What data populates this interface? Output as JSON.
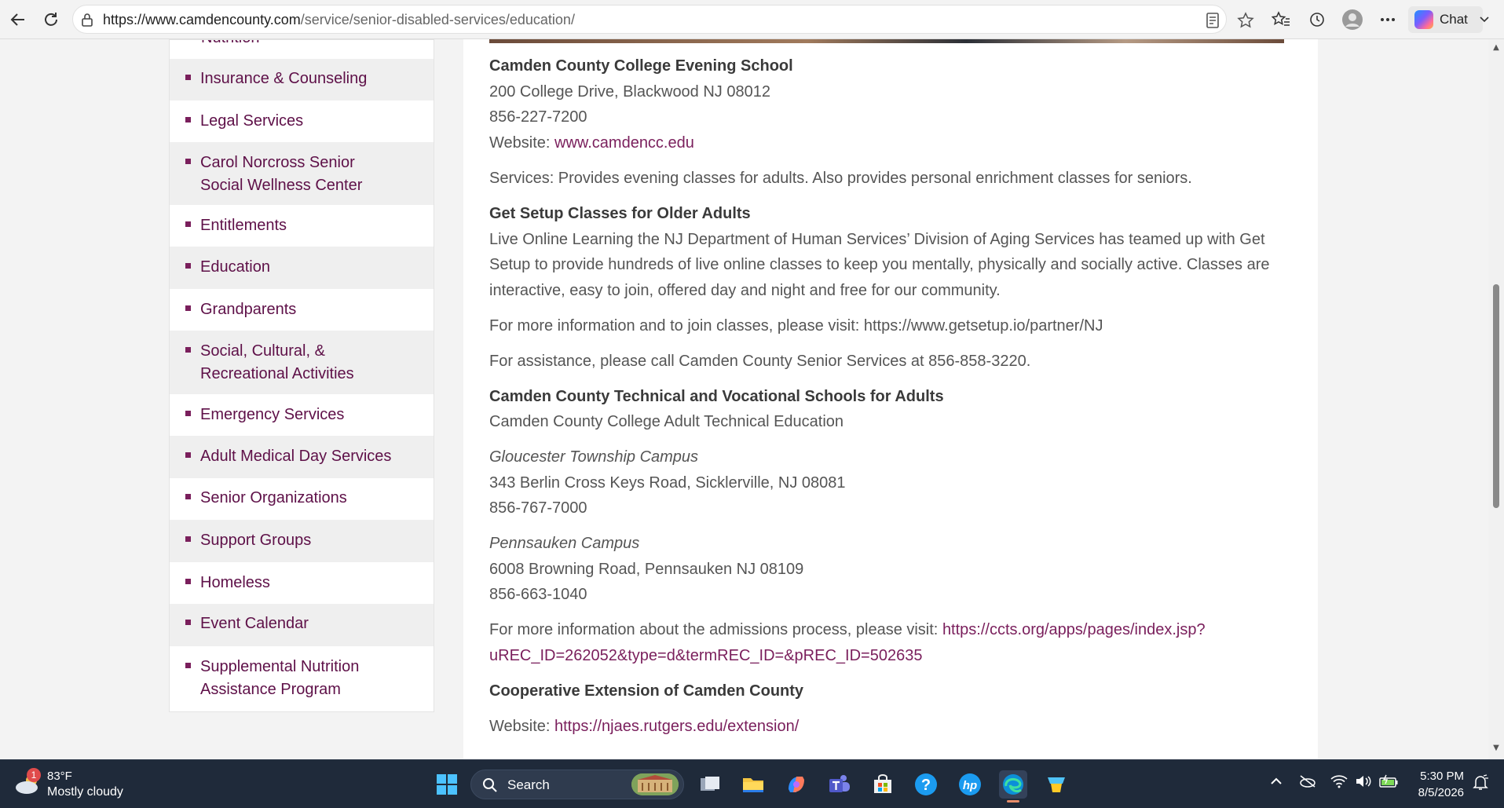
{
  "browser": {
    "url_host": "https://www.camdencounty.com",
    "url_path": "/service/senior-disabled-services/education/",
    "chat_label": "Chat"
  },
  "sidebar": {
    "cut_label": "Nutrition",
    "items": [
      {
        "label": "Insurance & Counseling"
      },
      {
        "label": "Legal Services"
      },
      {
        "label": "Carol Norcross Senior Social Wellness Center"
      },
      {
        "label": "Entitlements"
      },
      {
        "label": "Education"
      },
      {
        "label": "Grandparents"
      },
      {
        "label": "Social, Cultural, & Recreational Activities"
      },
      {
        "label": "Emergency Services"
      },
      {
        "label": "Adult Medical Day Services"
      },
      {
        "label": "Senior Organizations"
      },
      {
        "label": "Support Groups"
      },
      {
        "label": "Homeless"
      },
      {
        "label": "Event Calendar"
      },
      {
        "label": "Supplemental Nutrition Assistance Program"
      }
    ]
  },
  "content": {
    "ccc_title": "Camden County College Evening School",
    "ccc_address": "200 College Drive, Blackwood NJ 08012",
    "ccc_phone": "856-227-7200",
    "website_label": "Website: ",
    "ccc_link": "www.camdencc.edu",
    "ccc_services": "Services: Provides evening classes for adults. Also provides personal enrichment classes for seniors.",
    "getsetup_title": "Get Setup Classes for Older Adults",
    "getsetup_line1": "Live Online Learning the NJ Department of Human Services’ Division of Aging Services has teamed up with Get",
    "getsetup_line2": "Setup to provide hundreds of live online classes to keep you mentally, physically and socially active. Classes are",
    "getsetup_line3": "interactive, easy to join, offered day and night and free for our community.",
    "getsetup_info": "For more information and to join classes, please visit: https://www.getsetup.io/partner/NJ",
    "getsetup_assist": "For assistance, please call Camden County Senior Services at 856-858-3220.",
    "tech_title": "Camden County Technical and Vocational Schools for Adults",
    "tech_sub": "Camden County College Adult Technical Education",
    "gloucester_campus": "Gloucester Township Campus",
    "gloucester_address": "343 Berlin Cross Keys Road, Sicklerville, NJ 08081",
    "gloucester_phone": "856-767-7000",
    "pennsauken_campus": "Pennsauken Campus",
    "pennsauken_address": "6008 Browning Road, Pennsauken NJ 08109",
    "pennsauken_phone": "856-663-1040",
    "admissions_text": "For more information about the admissions process, please visit: ",
    "admissions_link1": "https://ccts.org/apps/pages/index.jsp?",
    "admissions_link2": "uREC_ID=262052&type=d&termREC_ID=&pREC_ID=502635",
    "coop_title": "Cooperative Extension of Camden County",
    "coop_link": "https://njaes.rutgers.edu/extension/"
  },
  "taskbar": {
    "weather_badge": "1",
    "temperature": "83°F",
    "condition": "Mostly cloudy",
    "search_label": "Search",
    "time": "5:30 PM",
    "date": "8/5/2026"
  },
  "colors": {
    "link": "#7a1f5c",
    "sidebar_text": "#5e1048",
    "taskbar_bg": "#1f2a3a"
  }
}
